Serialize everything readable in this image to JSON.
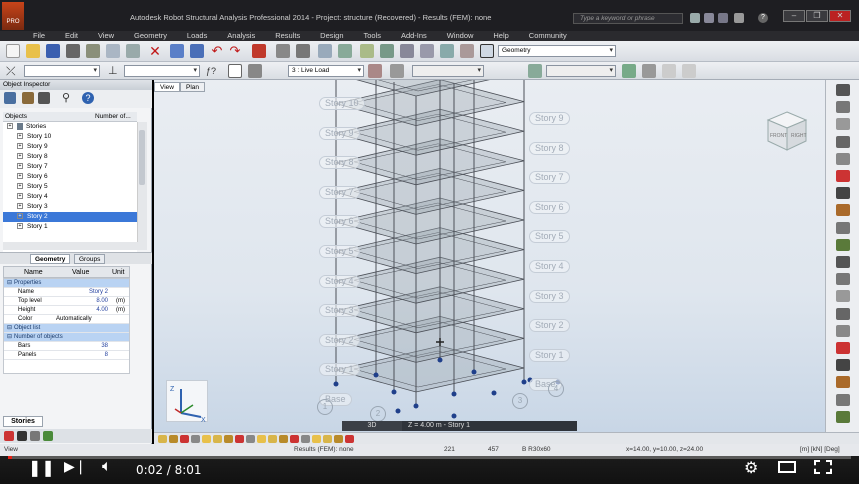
{
  "titlebar": {
    "logo_label": "PRO",
    "title": "Autodesk Robot Structural Analysis Professional 2014 - Project: structure (Recovered) - Results (FEM): none",
    "search_placeholder": "Type a keyword or phrase"
  },
  "menu": [
    "File",
    "Edit",
    "View",
    "Geometry",
    "Loads",
    "Analysis",
    "Results",
    "Design",
    "Tools",
    "Add-Ins",
    "Window",
    "Help",
    "Community"
  ],
  "toolbar": {
    "layout_combo": "Geometry",
    "load_case_combo": "3 : Live Load"
  },
  "inspector": {
    "title": "Object Inspector",
    "tree_headers": {
      "objects": "Objects",
      "number": "Number of..."
    },
    "tree_items": [
      {
        "label": "Stories",
        "level": 0,
        "selected": false
      },
      {
        "label": "Story 10",
        "level": 1,
        "selected": false
      },
      {
        "label": "Story 9",
        "level": 1,
        "selected": false
      },
      {
        "label": "Story 8",
        "level": 1,
        "selected": false
      },
      {
        "label": "Story 7",
        "level": 1,
        "selected": false
      },
      {
        "label": "Story 6",
        "level": 1,
        "selected": false
      },
      {
        "label": "Story 5",
        "level": 1,
        "selected": false
      },
      {
        "label": "Story 4",
        "level": 1,
        "selected": false
      },
      {
        "label": "Story 3",
        "level": 1,
        "selected": false
      },
      {
        "label": "Story 2",
        "level": 1,
        "selected": true
      },
      {
        "label": "Story 1",
        "level": 1,
        "selected": false
      }
    ],
    "tabs": [
      "Geometry",
      "Groups"
    ],
    "prop_headers": {
      "name": "Name",
      "value": "Value",
      "unit": "Unit"
    },
    "props": [
      {
        "section": true,
        "name": "Properties",
        "value": "",
        "unit": ""
      },
      {
        "section": false,
        "name": "Name",
        "value": "Story 2",
        "unit": ""
      },
      {
        "section": false,
        "name": "Top level",
        "value": "8.00",
        "unit": "(m)"
      },
      {
        "section": false,
        "name": "Height",
        "value": "4.00",
        "unit": "(m)"
      },
      {
        "section": false,
        "name": "Color",
        "value": "Automatically",
        "unit": ""
      },
      {
        "section": true,
        "name": "Object list",
        "value": "",
        "unit": ""
      },
      {
        "section": true,
        "name": "Number of objects",
        "value": "",
        "unit": ""
      },
      {
        "section": false,
        "name": "Bars",
        "value": "38",
        "unit": ""
      },
      {
        "section": false,
        "name": "Panels",
        "value": "8",
        "unit": ""
      }
    ],
    "bottom_tab": "Stories"
  },
  "viewport": {
    "tabs": [
      "View",
      "Plan"
    ],
    "stories_left": [
      "Story 10",
      "Story 9",
      "Story 8",
      "Story 7",
      "Story 6",
      "Story 5",
      "Story 4",
      "Story 3",
      "Story 2",
      "Story 1",
      "Base"
    ],
    "stories_right": [
      "Story 9",
      "Story 8",
      "Story 7",
      "Story 6",
      "Story 5",
      "Story 4",
      "Story 3",
      "Story 2",
      "Story 1",
      "Base"
    ],
    "grid_labels": [
      "1",
      "2",
      "3",
      "4"
    ],
    "viewcube": {
      "front": "FRONT",
      "right": "RIGHT"
    },
    "status_3d": "3D",
    "status_z": "Z = 4.00 m - Story 1",
    "axes": {
      "z": "Z",
      "x": "X",
      "y": "Y"
    }
  },
  "statusbar": {
    "view": "View",
    "results": "Results (FEM): none",
    "n1": "221",
    "n2": "457",
    "section": "B R30x60",
    "coords": "x=14.00, y=10.00, z=24.00",
    "units": "[m] [kN] [Deg]"
  },
  "player": {
    "time": "0:02 / 8:01",
    "progress": 0.004
  }
}
